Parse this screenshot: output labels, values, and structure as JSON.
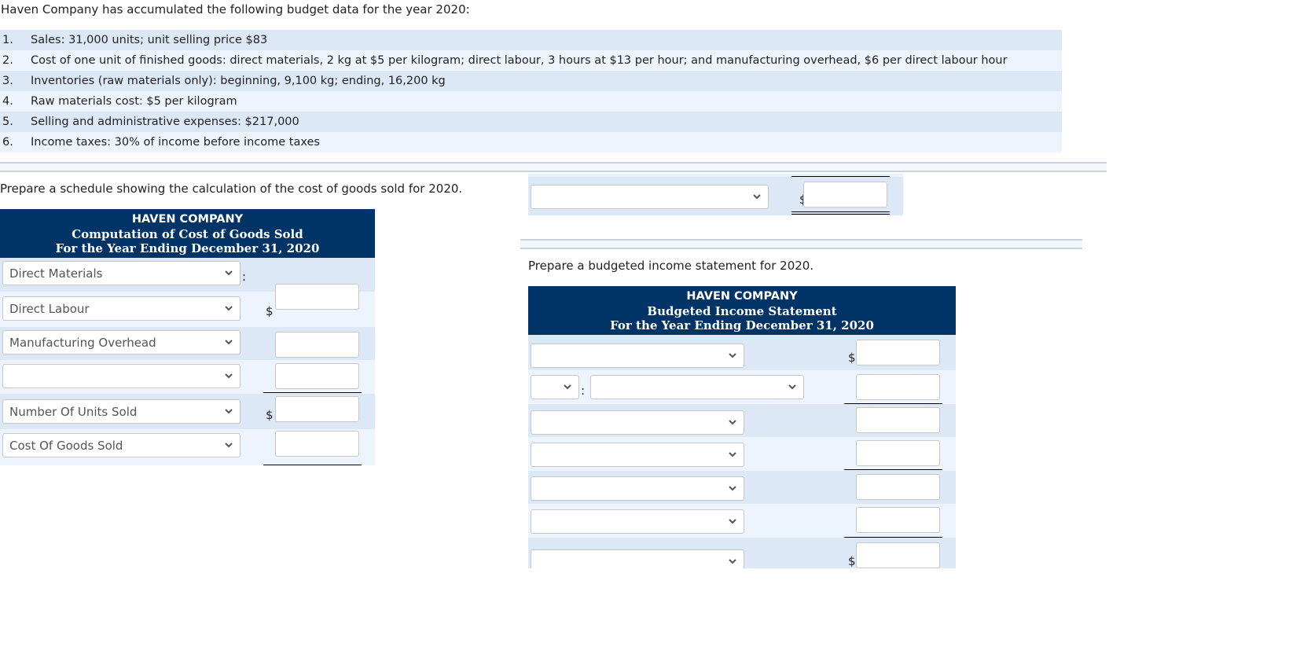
{
  "intro": "Haven Company has accumulated the following budget data for the year 2020:",
  "budget_items": [
    {
      "num": "1.",
      "text": "Sales: 31,000 units; unit selling price $83"
    },
    {
      "num": "2.",
      "text": "Cost of one unit of finished goods: direct materials, 2 kg at $5 per kilogram; direct labour, 3 hours at $13 per hour; and manufacturing overhead, $6 per direct labour hour"
    },
    {
      "num": "3.",
      "text": "Inventories (raw materials only): beginning, 9,100 kg; ending, 16,200 kg"
    },
    {
      "num": "4.",
      "text": "Raw materials cost: $5 per kilogram"
    },
    {
      "num": "5.",
      "text": "Selling and administrative expenses: $217,000"
    },
    {
      "num": "6.",
      "text": "Income taxes: 30% of income before income taxes"
    }
  ],
  "cogs": {
    "prompt": "Prepare a schedule showing the calculation of the cost of goods sold for 2020.",
    "header": {
      "company": "HAVEN COMPANY",
      "title": "Computation of Cost of Goods Sold",
      "period": "For the Year Ending December 31, 2020"
    },
    "rows": [
      {
        "select": "Direct Materials",
        "colon": ":",
        "dollar": "",
        "amount": ""
      },
      {
        "select": "Direct Labour",
        "dollar": "$",
        "amount": ""
      },
      {
        "select": "Manufacturing Overhead",
        "dollar": "",
        "amount": ""
      },
      {
        "select": "",
        "dollar": "",
        "amount": ""
      },
      {
        "select": "Number Of Units Sold",
        "dollar": "$",
        "amount": ""
      },
      {
        "select": "Cost Of Goods Sold",
        "dollar": "",
        "amount": ""
      }
    ],
    "total": {
      "select": "",
      "dollar": "$",
      "amount": ""
    }
  },
  "income": {
    "prompt": "Prepare a budgeted income statement for 2020.",
    "header": {
      "company": "HAVEN COMPANY",
      "title": "Budgeted Income Statement",
      "period": "For the Year Ending December 31, 2020"
    },
    "rows": [
      {
        "select": "",
        "dollar": "$",
        "amount": ""
      },
      {
        "prefix_select": "",
        "colon": ":",
        "select": "",
        "amount": ""
      },
      {
        "select": "",
        "amount": ""
      },
      {
        "select": "",
        "amount": ""
      },
      {
        "select": "",
        "amount": ""
      },
      {
        "select": "",
        "amount": ""
      },
      {
        "select": "",
        "dollar": "$",
        "amount": ""
      }
    ]
  },
  "colors": {
    "header_bg": "#003366",
    "row_dark": "#dde8f7",
    "row_light": "#edf4fd"
  }
}
